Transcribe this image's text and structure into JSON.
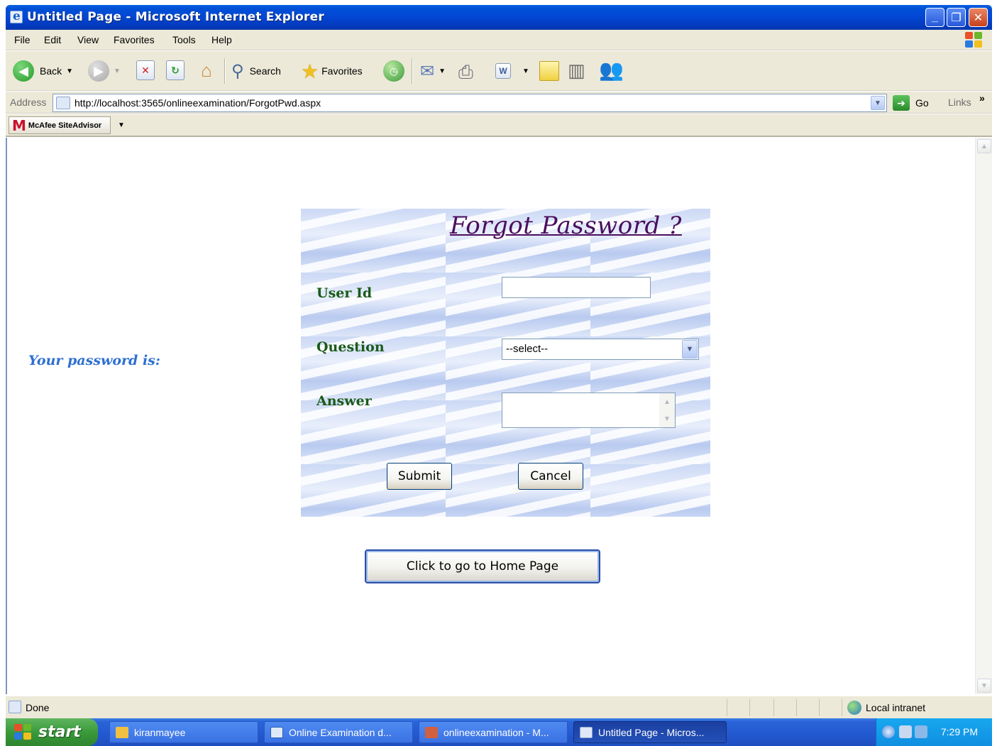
{
  "window": {
    "title": "Untitled Page - Microsoft Internet Explorer",
    "minimize": "_",
    "restore": "❐",
    "close": "✕"
  },
  "menu": {
    "items": [
      "File",
      "Edit",
      "View",
      "Favorites",
      "Tools",
      "Help"
    ]
  },
  "toolbar": {
    "back_label": "Back",
    "search_label": "Search",
    "favorites_label": "Favorites"
  },
  "address": {
    "label": "Address",
    "url": "http://localhost:3565/onlineexamination/ForgotPwd.aspx",
    "go_label": "Go",
    "links_label": "Links",
    "links_more": "»"
  },
  "mcafee": {
    "label": "McAfee SiteAdvisor"
  },
  "page": {
    "password_label": "Your password is:",
    "form": {
      "title": "Forgot Password ?",
      "user_id_label": "User Id",
      "user_id_value": "",
      "question_label": "Question",
      "question_selected": "--select--",
      "answer_label": "Answer",
      "answer_value": "",
      "submit_label": "Submit",
      "cancel_label": "Cancel"
    },
    "home_button_label": "Click to go to Home Page"
  },
  "status": {
    "text": "Done",
    "zone": "Local intranet"
  },
  "taskbar": {
    "start_label": "start",
    "tasks": [
      {
        "label": "kiranmayee",
        "icon_color": "#f0c040"
      },
      {
        "label": "Online Examination d...",
        "icon_color": "#2a5fb8"
      },
      {
        "label": "onlineexamination - M...",
        "icon_color": "#d06040"
      },
      {
        "label": "Untitled Page - Micros...",
        "icon_color": "#dfe8f6"
      }
    ],
    "clock": "7:29 PM"
  },
  "colors": {
    "title_blue": "#0346d4",
    "form_title": "#4a0e5e",
    "form_label": "#1a5a1a",
    "password_label": "#2d6fd2"
  }
}
